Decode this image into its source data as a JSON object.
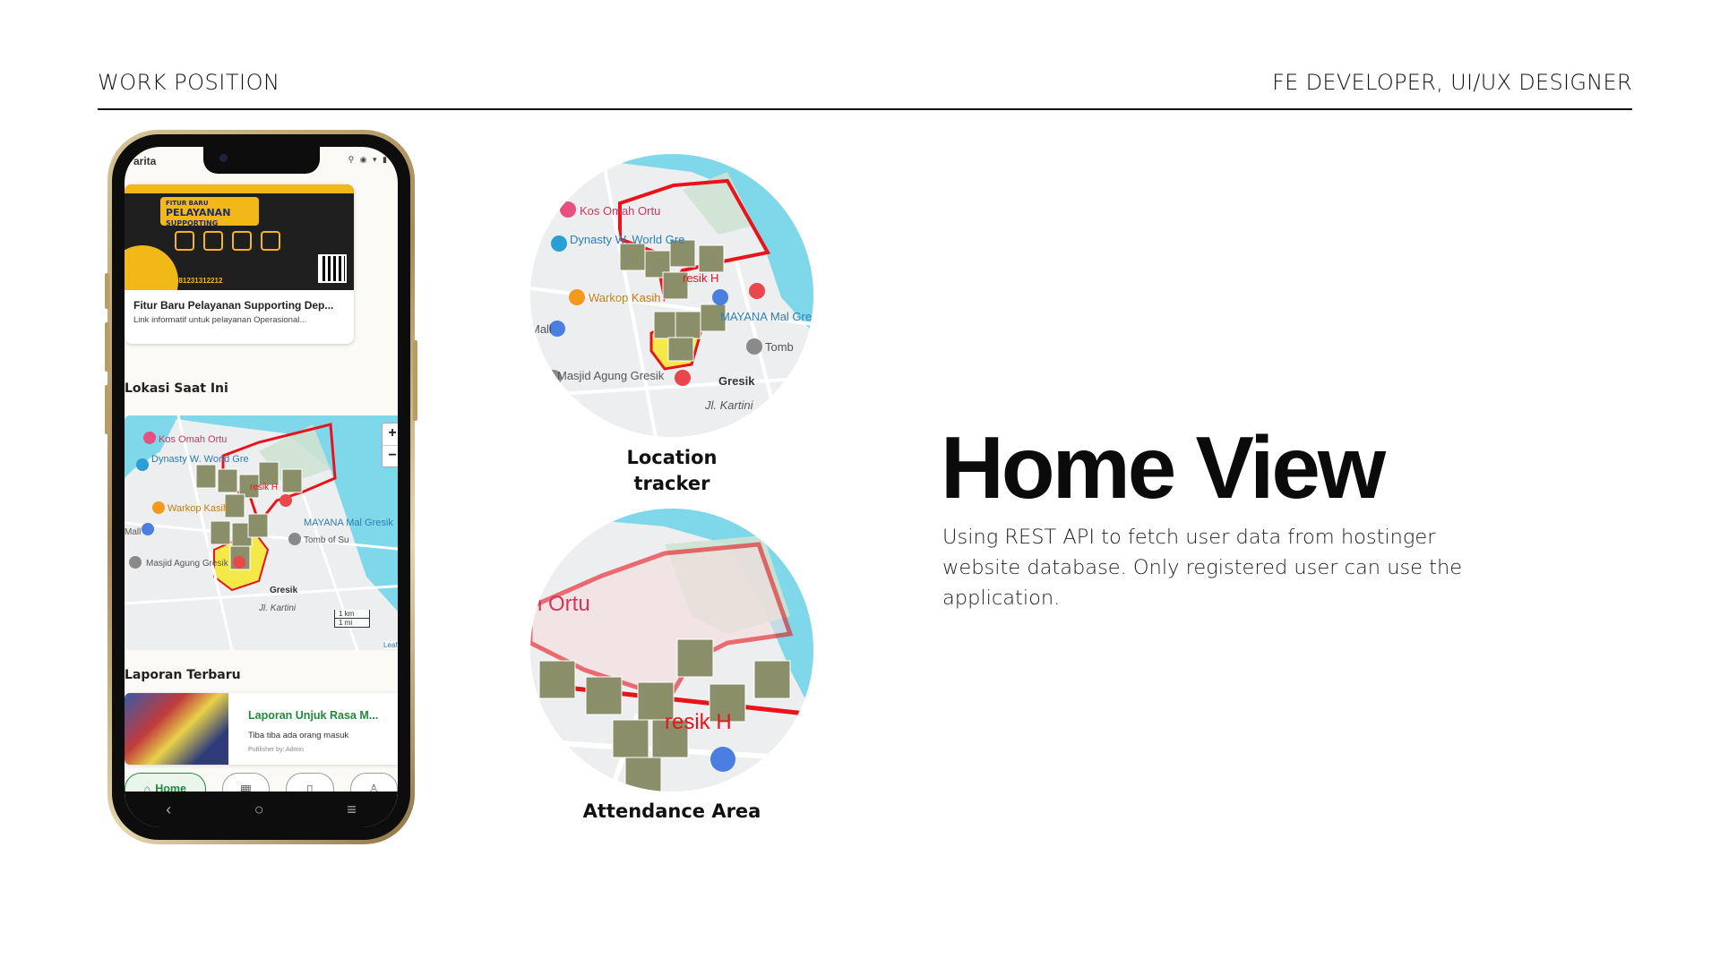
{
  "header": {
    "left_label": "WORK POSITION",
    "right_label": "FE DEVELOPER, UI/UX DESIGNER"
  },
  "phone": {
    "status_time": "arita",
    "status_icons": "⚲ ◉ ▾ ▮",
    "promo": {
      "badge_line1": "FITUR BARU",
      "badge_line2": "PELAYANAN",
      "badge_line3": "SUPPORTING",
      "phone_number": "081231312212",
      "title": "Fitur Baru Pelayanan Supporting Dep...",
      "subtitle": "Link informatif untuk pelayanan Operasional..."
    },
    "current_location_heading": "Lokasi Saat Ini",
    "map": {
      "zoom_in": "+",
      "zoom_out": "−",
      "scale_km": "1 km",
      "scale_mi": "1 mi",
      "attribution": "Leaflet",
      "places": {
        "kos": "Kos Omah Ortu",
        "dynasty": "Dynasty W. World Gre",
        "warkop": "Warkop Kasih",
        "mayana": "MAYANA Mal Gresik",
        "tomb": "Tomb of Su",
        "masjid": "Masjid Agung Gresik",
        "gresik": "Gresik",
        "kartini": "Jl. Kartini",
        "mall": "Mall",
        "gresik_h": "resik H"
      }
    },
    "latest_reports_heading": "Laporan Terbaru",
    "report": {
      "title": "Laporan Unjuk Rasa M...",
      "subtitle": "Tiba tiba ada orang masuk",
      "meta": "Publisher by: Admin"
    },
    "nav": {
      "home": "Home",
      "calendar_icon": "▦",
      "document_icon": "▯",
      "profile_icon": "♙"
    },
    "system_nav": {
      "back": "‹",
      "home": "○",
      "menu": "≡"
    }
  },
  "circle_top": {
    "label_line1": "Location",
    "label_line2": "tracker",
    "places": {
      "kos": "Kos Omah Ortu",
      "dynasty": "Dynasty W. World Gre",
      "warkop": "Warkop Kasih",
      "mayana": "MAYANA Mal Gres",
      "tomb": "Tomb",
      "masjid": "Masjid Agung Gresik",
      "gresik": "Gresik",
      "kartini": "Jl. Kartini",
      "mall": "Mall",
      "gresik_h": "resik H"
    }
  },
  "circle_bottom": {
    "label": "Attendance Area",
    "places": {
      "ortu": "h Ortu",
      "gresik_h": "resik H"
    }
  },
  "title": "Home View",
  "description": "Using REST API to fetch user data from hostinger website database. Only registered user can use the application.",
  "colors": {
    "accent_green": "#1f8a3c",
    "boundary_red": "#e8141c",
    "water": "#7fd7ea",
    "zone_yellow": "#f5e94a"
  }
}
